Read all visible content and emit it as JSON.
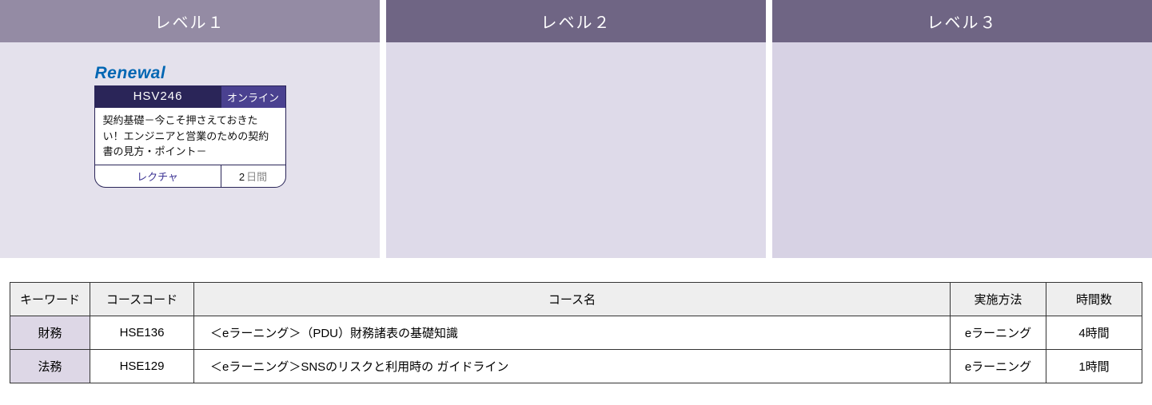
{
  "levels": {
    "headers": [
      "レベル１",
      "レベル２",
      "レベル３"
    ]
  },
  "card": {
    "renewal": "Renewal",
    "code": "HSV246",
    "mode": "オンライン",
    "title": "契約基礎－今こそ押さえておきたい！エンジニアと営業のための契約書の見方・ポイント－",
    "type": "レクチャ",
    "days_num": "2",
    "days_unit": "日間"
  },
  "table": {
    "headers": {
      "keyword": "キーワード",
      "code": "コースコード",
      "name": "コース名",
      "method": "実施方法",
      "hours": "時間数"
    },
    "rows": [
      {
        "keyword": "財務",
        "code": "HSE136",
        "name": "＜eラーニング＞（PDU）財務諸表の基礎知識",
        "method": "eラーニング",
        "hours": "4時間"
      },
      {
        "keyword": "法務",
        "code": "HSE129",
        "name": "＜eラーニング＞SNSのリスクと利用時の ガイドライン",
        "method": "eラーニング",
        "hours": "1時間"
      }
    ]
  }
}
